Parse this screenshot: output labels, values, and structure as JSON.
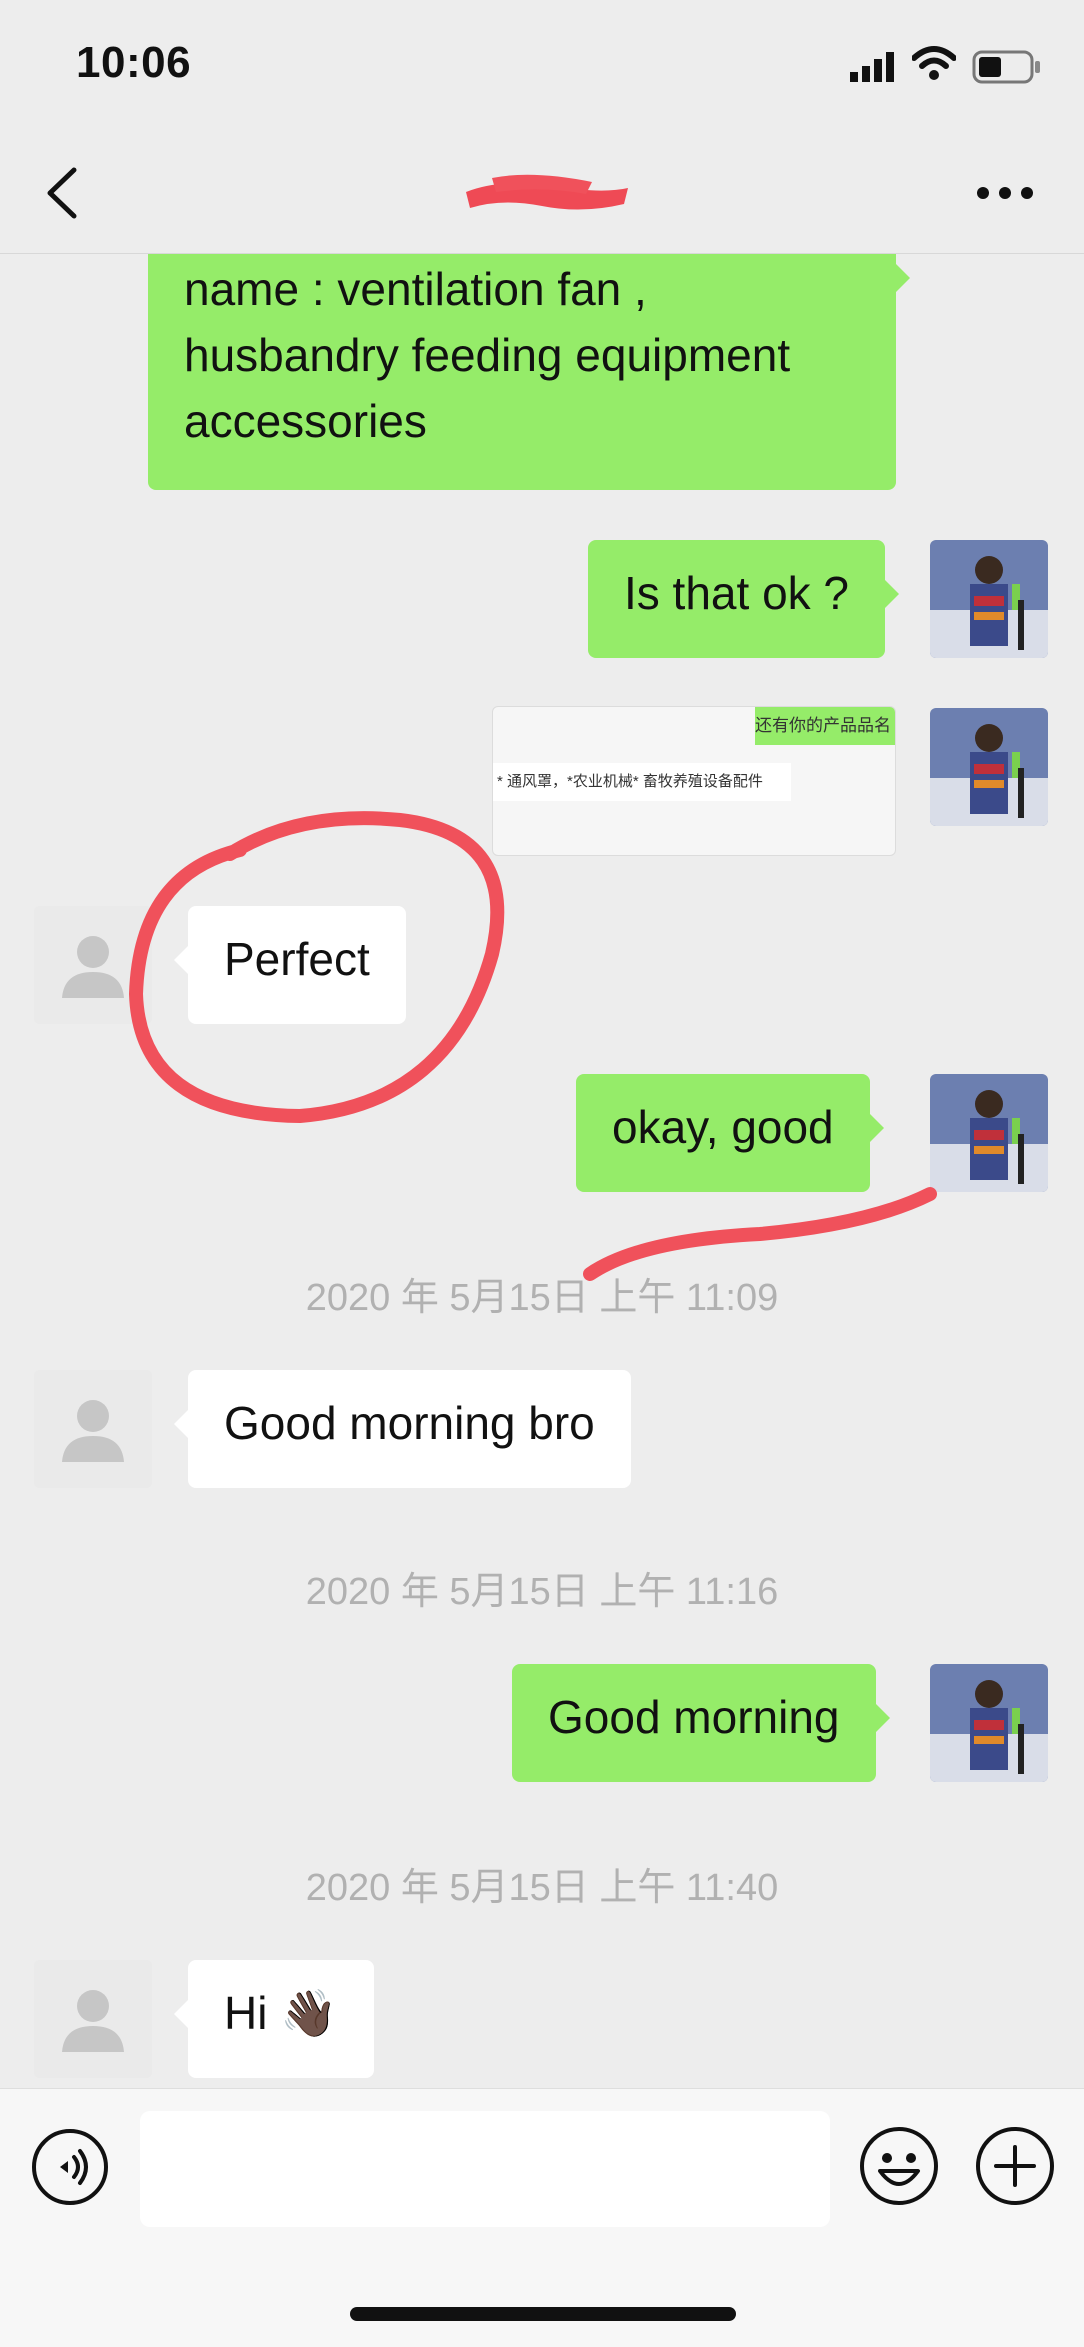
{
  "status_bar": {
    "time": "10:06"
  },
  "nav": {
    "title": ""
  },
  "messages": {
    "m1": {
      "lines": [
        "name : ventilation fan ,",
        "husbandry feeding equipment",
        "accessories"
      ]
    },
    "m2": "Is that ok ?",
    "m3_image": {
      "green_text": "还有你的产品品名",
      "white_text": "* 通风罩，*农业机械* 畜牧养殖设备配件"
    },
    "m4": "Perfect",
    "m5": "okay, good",
    "ts1": "2020 年 5月15日 上午 11:09",
    "m6": "Good morning bro",
    "ts2": "2020 年 5月15日 上午 11:16",
    "m7": "Good morning",
    "ts3": "2020 年 5月15日 上午 11:40",
    "m8": "Hi 👋🏿"
  },
  "input": {
    "value": "",
    "placeholder": ""
  },
  "icons": {
    "back": "chevron-left-icon",
    "more": "more-icon",
    "voice": "voice-icon",
    "emoji": "emoji-icon",
    "plus": "plus-icon"
  },
  "colors": {
    "outgoing_bubble": "#95ec69",
    "incoming_bubble": "#ffffff",
    "background": "#ededed",
    "annotation_red": "#f0515b"
  }
}
